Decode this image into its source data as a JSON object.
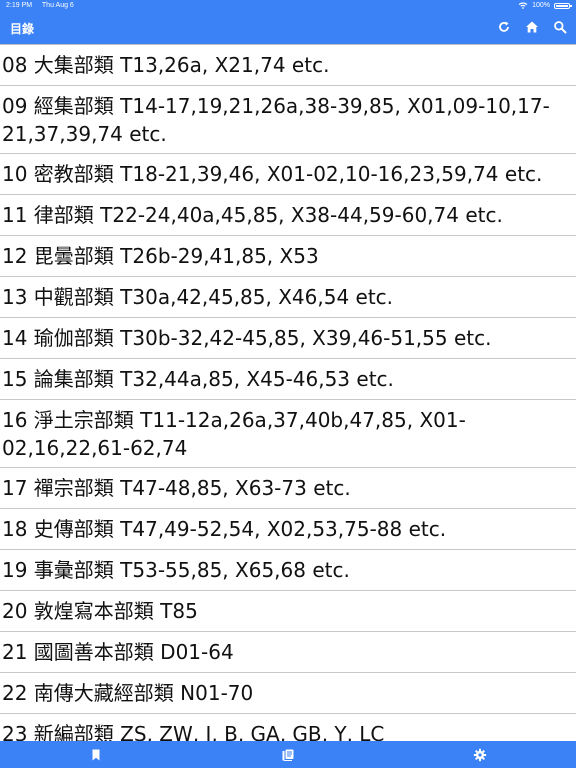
{
  "status_bar": {
    "time": "2:19 PM",
    "date": "Thu Aug 6",
    "battery": "100%"
  },
  "header": {
    "title": "目錄"
  },
  "rows": [
    "08 大集部類 T13,26a, X21,74 etc.",
    "09 經集部類 T14-17,19,21,26a,38-39,85, X01,09-10,17-21,37,39,74 etc.",
    "10 密教部類 T18-21,39,46, X01-02,10-16,23,59,74 etc.",
    "11 律部類 T22-24,40a,45,85, X38-44,59-60,74 etc.",
    "12 毘曇部類 T26b-29,41,85, X53",
    "13 中觀部類 T30a,42,45,85, X46,54 etc.",
    "14 瑜伽部類 T30b-32,42-45,85, X39,46-51,55 etc.",
    "15 論集部類 T32,44a,85, X45-46,53 etc.",
    "16 淨土宗部類 T11-12a,26a,37,40b,47,85, X01-02,16,22,61-62,74",
    "17 禪宗部類 T47-48,85, X63-73 etc.",
    "18 史傳部類 T47,49-52,54, X02,53,75-88 etc.",
    "19 事彙部類 T53-55,85, X65,68 etc.",
    "20 敦煌寫本部類 T85",
    "21 國圖善本部類 D01-64",
    "22 南傳大藏經部類 N01-70",
    "23 新編部類 ZS, ZW, I, B, GA, GB, Y, LC"
  ]
}
